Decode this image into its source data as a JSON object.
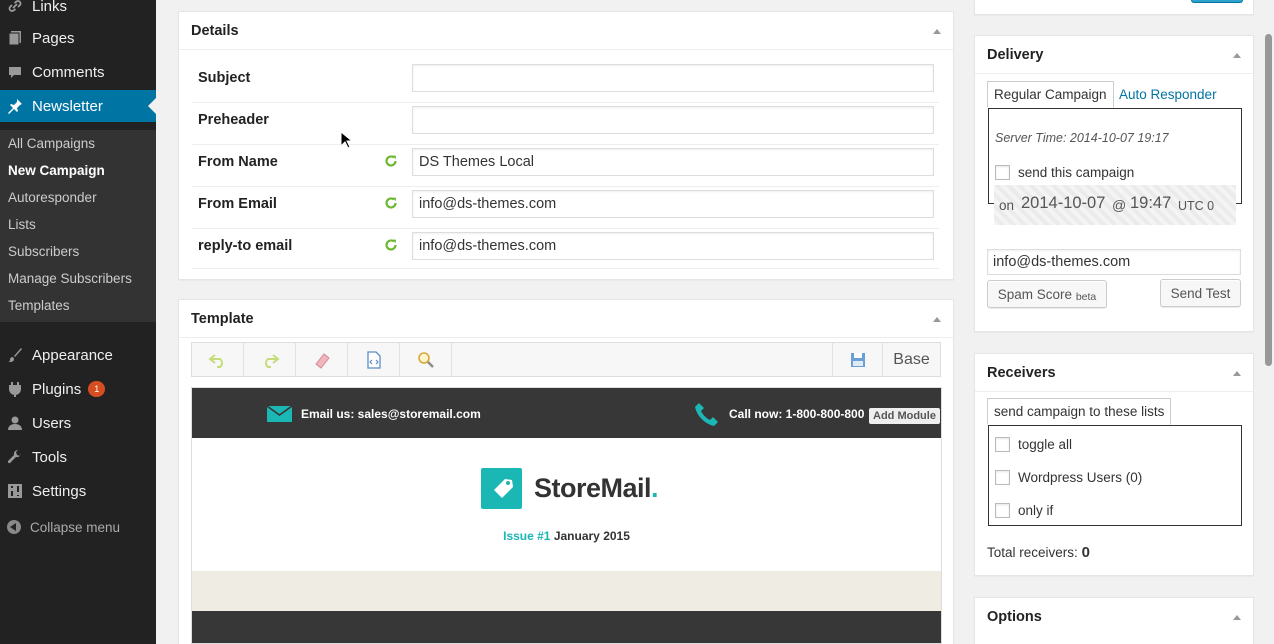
{
  "sidebar": {
    "menu": [
      {
        "label": "Links",
        "icon": "link-icon"
      },
      {
        "label": "Pages",
        "icon": "pages-icon"
      },
      {
        "label": "Comments",
        "icon": "comments-icon"
      },
      {
        "label": "Newsletter",
        "icon": "pushpin-icon"
      },
      {
        "label": "Appearance",
        "icon": "paintbrush-icon"
      },
      {
        "label": "Plugins",
        "icon": "plugin-icon",
        "badge": "1"
      },
      {
        "label": "Users",
        "icon": "users-icon"
      },
      {
        "label": "Tools",
        "icon": "wrench-icon"
      },
      {
        "label": "Settings",
        "icon": "settings-icon"
      }
    ],
    "submenu": [
      "All Campaigns",
      "New Campaign",
      "Autoresponder",
      "Lists",
      "Subscribers",
      "Manage Subscribers",
      "Templates"
    ],
    "collapse_label": "Collapse menu"
  },
  "details": {
    "title": "Details",
    "rows": [
      {
        "label": "Subject",
        "value": ""
      },
      {
        "label": "Preheader",
        "value": ""
      },
      {
        "label": "From Name",
        "value": "DS Themes Local"
      },
      {
        "label": "From Email",
        "value": "info@ds-themes.com"
      },
      {
        "label": "reply-to email",
        "value": "info@ds-themes.com"
      }
    ]
  },
  "template": {
    "title": "Template",
    "base_label": "Base",
    "email": {
      "email_us": "Email us: sales@storemail.com",
      "call_now": "Call now: 1-800-800-800",
      "add_module": "Add Module",
      "brand": "StoreMail",
      "brand_dot": ".",
      "issue": "Issue #1",
      "issue_date": "January 2015"
    }
  },
  "delivery": {
    "title": "Delivery",
    "tabs": [
      "Regular Campaign",
      "Auto Responder"
    ],
    "server_time": "Server Time: 2014-10-07 19:17",
    "send_label": "send this campaign",
    "on_label": "on",
    "date": "2014-10-07",
    "at": "@",
    "time": "19:47",
    "tz": "UTC 0",
    "test_email": "info@ds-themes.com",
    "spam_label": "Spam Score",
    "spam_beta": "beta",
    "send_test_label": "Send Test"
  },
  "receivers": {
    "title": "Receivers",
    "tab": "send campaign to these lists",
    "options": [
      "toggle all",
      "Wordpress Users (0)",
      "only if"
    ],
    "total_label": "Total receivers:",
    "total_value": "0"
  },
  "options": {
    "title": "Options"
  },
  "colors": {
    "accent": "#0074a2",
    "brand_teal": "#1bb7b5",
    "green_icon": "#6cb833"
  }
}
